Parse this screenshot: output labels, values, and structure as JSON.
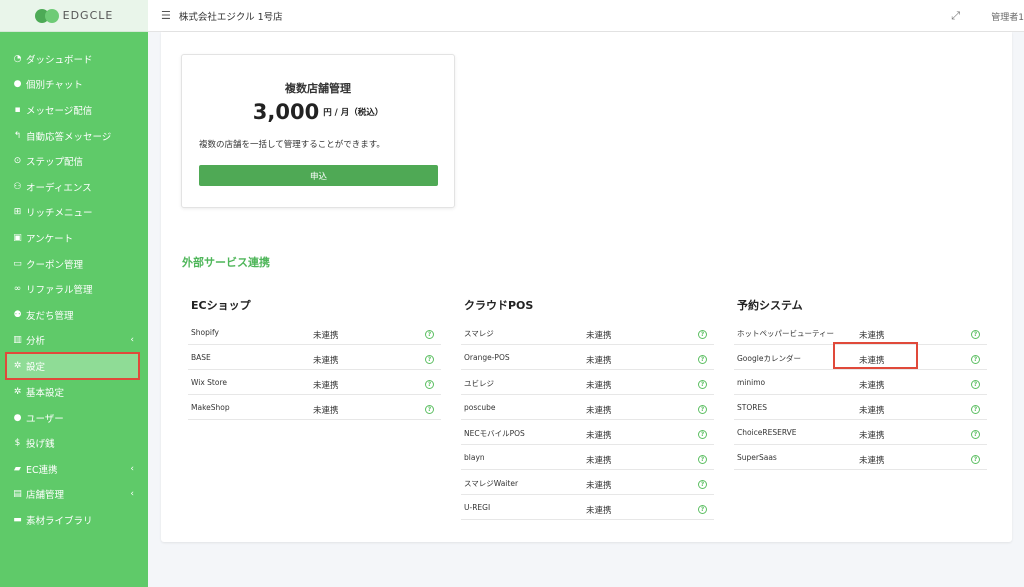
{
  "brand": {
    "name": "EDGCLE"
  },
  "sidebar": {
    "items": [
      {
        "label": "ダッシュボード",
        "icon": "dashboard-icon"
      },
      {
        "label": "個別チャット",
        "icon": "chat-icon"
      },
      {
        "label": "メッセージ配信",
        "icon": "message-icon"
      },
      {
        "label": "自動応答メッセージ",
        "icon": "reply-icon"
      },
      {
        "label": "ステップ配信",
        "icon": "play-icon"
      },
      {
        "label": "オーディエンス",
        "icon": "users-icon"
      },
      {
        "label": "リッチメニュー",
        "icon": "grid-icon"
      },
      {
        "label": "アンケート",
        "icon": "survey-icon"
      },
      {
        "label": "クーポン管理",
        "icon": "coupon-icon"
      },
      {
        "label": "リファラル管理",
        "icon": "link-icon"
      },
      {
        "label": "友だち管理",
        "icon": "friends-icon"
      },
      {
        "label": "分析",
        "icon": "chart-icon"
      },
      {
        "label": "設定",
        "icon": "gear-icon"
      },
      {
        "label": "基本設定",
        "icon": "gear-icon"
      },
      {
        "label": "ユーザー",
        "icon": "user-icon"
      },
      {
        "label": "投げ銭",
        "icon": "dollar-icon"
      },
      {
        "label": "EC連携",
        "icon": "bag-icon"
      },
      {
        "label": "店舗管理",
        "icon": "store-icon"
      },
      {
        "label": "素材ライブラリ",
        "icon": "folder-icon"
      }
    ],
    "active_index": 12,
    "accent_color": "#5fca69"
  },
  "topbar": {
    "store_name": "株式会社エジクル 1号店",
    "user_name": "管理者1"
  },
  "plan": {
    "title": "複数店舗管理",
    "price": "3,000",
    "unit": "円 / 月（税込）",
    "description": "複数の店舗を一括して管理することができます。",
    "button_label": "申込"
  },
  "external": {
    "title": "外部サービス連携",
    "columns": [
      {
        "title": "ECショップ",
        "rows": [
          {
            "name": "Shopify",
            "status": "未連携"
          },
          {
            "name": "BASE",
            "status": "未連携"
          },
          {
            "name": "Wix Store",
            "status": "未連携"
          },
          {
            "name": "MakeShop",
            "status": "未連携"
          }
        ]
      },
      {
        "title": "クラウドPOS",
        "rows": [
          {
            "name": "スマレジ",
            "status": "未連携"
          },
          {
            "name": "Orange-POS",
            "status": "未連携"
          },
          {
            "name": "ユビレジ",
            "status": "未連携"
          },
          {
            "name": "poscube",
            "status": "未連携"
          },
          {
            "name": "NECモバイルPOS",
            "status": "未連携"
          },
          {
            "name": "blayn",
            "status": "未連携"
          },
          {
            "name": "スマレジWaiter",
            "status": "未連携"
          },
          {
            "name": "U-REGI",
            "status": "未連携"
          }
        ]
      },
      {
        "title": "予約システム",
        "rows": [
          {
            "name": "ホットペッパービューティー",
            "status": "未連携"
          },
          {
            "name": "Googleカレンダー",
            "status": "未連携"
          },
          {
            "name": "minimo",
            "status": "未連携"
          },
          {
            "name": "STORES",
            "status": "未連携"
          },
          {
            "name": "ChoiceRESERVE",
            "status": "未連携"
          },
          {
            "name": "SuperSaas",
            "status": "未連携"
          }
        ]
      }
    ]
  },
  "colors": {
    "highlight": "#e0493a",
    "button": "#4fa955",
    "section_title": "#4fb65a"
  }
}
